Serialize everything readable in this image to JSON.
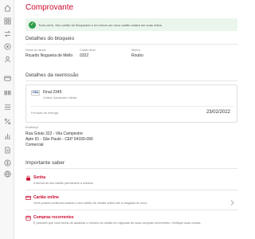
{
  "page": {
    "title": "Comprovante"
  },
  "banner": {
    "message": "Tudo certo. Seu cartão foi bloqueado e em breve um novo cartão estará em suas mãos."
  },
  "block_details": {
    "title": "Detalhes do bloqueio",
    "holder_label": "Nome do titular",
    "holder_value": "Ricardo Nogueira de Mello",
    "card_end_label": "Cartão final",
    "card_end_value": "0322",
    "reason_label": "Motivo",
    "reason_value": "Roubo"
  },
  "reissue_details": {
    "title": "Detalhes da reemissão",
    "card_brand": "VISA",
    "card_number": "Final 2345",
    "card_holder": "Unibes Santander Infinite",
    "delivery_label": "Previsão de entrega",
    "delivery_date": "23/02/2022",
    "address_label": "Endereço",
    "address_lines": [
      "Rua Goiás 322 - Vila Campestre",
      "Apto 91 - São Paulo - CEP 04330-090",
      "Comercial"
    ]
  },
  "important": {
    "title": "Importante saber",
    "items": [
      {
        "icon": "lock-icon",
        "title": "Senha",
        "desc": "A senha do seu cartão permanece a mesma."
      },
      {
        "icon": "card-icon",
        "title": "Cartão online",
        "desc": "Você poderá continuar usando o seu cartão de versão online até a chegada do novo."
      },
      {
        "icon": "calendar-icon",
        "title": "Compras recorrentes",
        "desc": "É possível que você tenha de atualizar o número do cartão em algumas de suas compras recorrentes. Verifique suas contas."
      }
    ]
  },
  "colors": {
    "accent": "#cc092f",
    "success": "#2e9e4a",
    "success_bg": "#eaf6ec"
  },
  "sidebar": {
    "icons": [
      "home-icon",
      "grid-icon",
      "transfer-icon",
      "target-icon",
      "user-icon",
      "card-icon",
      "barcode-icon",
      "list-icon",
      "percent-icon",
      "chart-icon",
      "doc-icon",
      "dollar-icon",
      "globe-icon"
    ]
  }
}
